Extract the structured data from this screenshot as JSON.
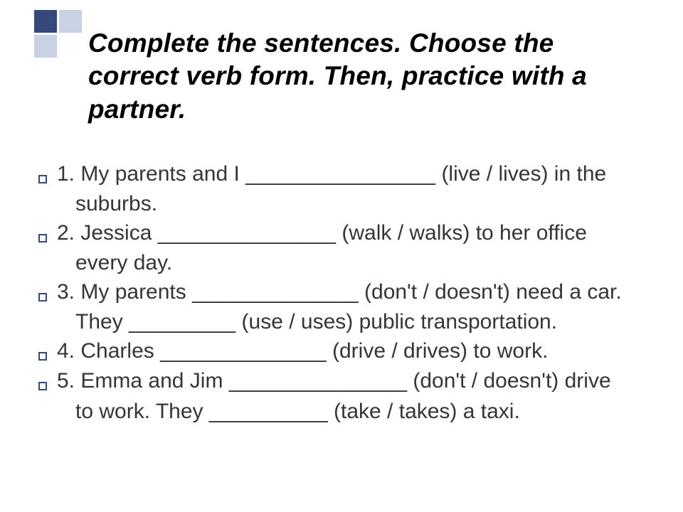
{
  "title": "Complete the sentences. Choose the correct verb form. Then, practice with a partner.",
  "items": [
    {
      "num": "1.",
      "line1": "My parents and I ________________ (live / lives) in the",
      "line2": "suburbs."
    },
    {
      "num": "2.",
      "line1": "Jessica _______________ (walk / walks) to her office",
      "line2": "every day."
    },
    {
      "num": "3.",
      "line1": "My parents ______________ (don't / doesn't) need a car.",
      "line2": "They _________ (use / uses) public transportation."
    },
    {
      "num": "4.",
      "line1": "Charles ______________ (drive / drives) to work.",
      "line2": ""
    },
    {
      "num": "5.",
      "line1": "Emma and Jim _______________ (don't / doesn't) drive",
      "line2": "to work. They __________ (take / takes) a taxi."
    }
  ]
}
